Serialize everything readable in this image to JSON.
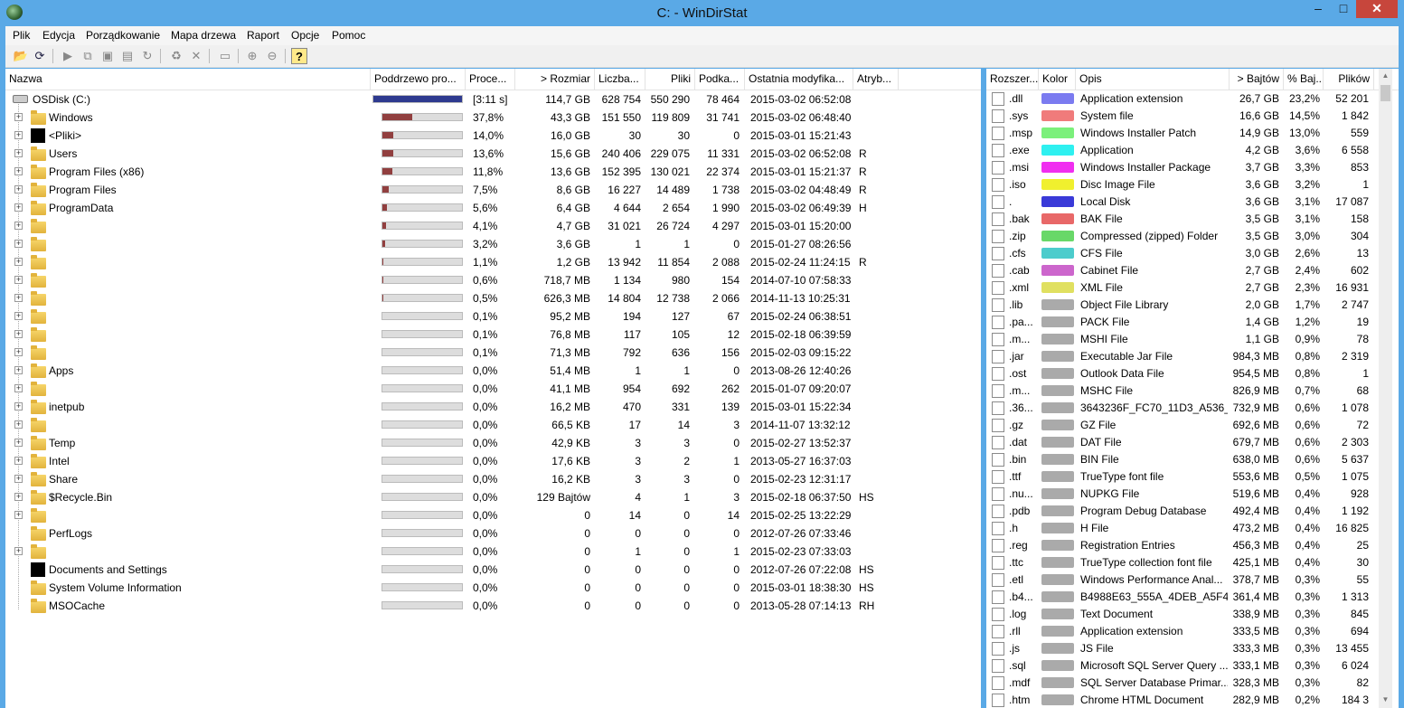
{
  "window": {
    "title": "C: - WinDirStat",
    "min": "–",
    "max": "□",
    "close": "✕"
  },
  "menu": [
    "Plik",
    "Edycja",
    "Porządkowanie",
    "Mapa drzewa",
    "Raport",
    "Opcje",
    "Pomoc"
  ],
  "toolbar_icons": [
    "open-folder-icon",
    "refresh-icon",
    "play-icon",
    "copy-icon",
    "explorer-icon",
    "cmd-icon",
    "refresh-selected-icon",
    "recycle-icon",
    "delete-icon",
    "new-folder-icon",
    "zoom-in-icon",
    "zoom-out-icon",
    "help-icon"
  ],
  "tree": {
    "headers": [
      "Nazwa",
      "Poddrzewo pro...",
      "Proce...",
      "> Rozmiar",
      "Liczba...",
      "Pliki",
      "Podka...",
      "Ostatnia modyfika...",
      "Atryb..."
    ],
    "rows": [
      {
        "name": "OSDisk (C:)",
        "icon": "drive-icon",
        "level": 0,
        "expand": false,
        "pct_fill": 1.0,
        "percent": "[3:11 s]",
        "size": "114,7 GB",
        "items": "628 754",
        "files": "550 290",
        "subdirs": "78 464",
        "modified": "2015-03-02  06:52:08",
        "attr": ""
      },
      {
        "name": "Windows",
        "icon": "folder-icon",
        "level": 1,
        "expand": true,
        "pct_fill": 0.378,
        "percent": "37,8%",
        "size": "43,3 GB",
        "items": "151 550",
        "files": "119 809",
        "subdirs": "31 741",
        "modified": "2015-03-02  06:48:40",
        "attr": ""
      },
      {
        "name": "<Pliki>",
        "icon": "files-icon",
        "level": 1,
        "expand": true,
        "pct_fill": 0.14,
        "percent": "14,0%",
        "size": "16,0 GB",
        "items": "30",
        "files": "30",
        "subdirs": "0",
        "modified": "2015-03-01  15:21:43",
        "attr": ""
      },
      {
        "name": "Users",
        "icon": "folder-icon",
        "level": 1,
        "expand": true,
        "pct_fill": 0.136,
        "percent": "13,6%",
        "size": "15,6 GB",
        "items": "240 406",
        "files": "229 075",
        "subdirs": "11 331",
        "modified": "2015-03-02  06:52:08",
        "attr": "R"
      },
      {
        "name": "Program Files (x86)",
        "icon": "folder-icon",
        "level": 1,
        "expand": true,
        "pct_fill": 0.118,
        "percent": "11,8%",
        "size": "13,6 GB",
        "items": "152 395",
        "files": "130 021",
        "subdirs": "22 374",
        "modified": "2015-03-01  15:21:37",
        "attr": "R"
      },
      {
        "name": "Program Files",
        "icon": "folder-icon",
        "level": 1,
        "expand": true,
        "pct_fill": 0.075,
        "percent": "7,5%",
        "size": "8,6 GB",
        "items": "16 227",
        "files": "14 489",
        "subdirs": "1 738",
        "modified": "2015-03-02  04:48:49",
        "attr": "R"
      },
      {
        "name": "ProgramData",
        "icon": "folder-icon",
        "level": 1,
        "expand": true,
        "pct_fill": 0.056,
        "percent": "5,6%",
        "size": "6,4 GB",
        "items": "4 644",
        "files": "2 654",
        "subdirs": "1 990",
        "modified": "2015-03-02  06:49:39",
        "attr": "H"
      },
      {
        "name": "",
        "icon": "folder-icon",
        "level": 1,
        "expand": true,
        "pct_fill": 0.041,
        "percent": "4,1%",
        "size": "4,7 GB",
        "items": "31 021",
        "files": "26 724",
        "subdirs": "4 297",
        "modified": "2015-03-01  15:20:00",
        "attr": ""
      },
      {
        "name": "",
        "icon": "folder-icon",
        "level": 1,
        "expand": true,
        "pct_fill": 0.032,
        "percent": "3,2%",
        "size": "3,6 GB",
        "items": "1",
        "files": "1",
        "subdirs": "0",
        "modified": "2015-01-27  08:26:56",
        "attr": ""
      },
      {
        "name": "",
        "icon": "folder-icon",
        "level": 1,
        "expand": true,
        "pct_fill": 0.011,
        "percent": "1,1%",
        "size": "1,2 GB",
        "items": "13 942",
        "files": "11 854",
        "subdirs": "2 088",
        "modified": "2015-02-24  11:24:15",
        "attr": "R"
      },
      {
        "name": "",
        "icon": "folder-icon",
        "level": 1,
        "expand": true,
        "pct_fill": 0.006,
        "percent": "0,6%",
        "size": "718,7 MB",
        "items": "1 134",
        "files": "980",
        "subdirs": "154",
        "modified": "2014-07-10  07:58:33",
        "attr": ""
      },
      {
        "name": "",
        "icon": "folder-icon",
        "level": 1,
        "expand": true,
        "pct_fill": 0.005,
        "percent": "0,5%",
        "size": "626,3 MB",
        "items": "14 804",
        "files": "12 738",
        "subdirs": "2 066",
        "modified": "2014-11-13  10:25:31",
        "attr": ""
      },
      {
        "name": "",
        "icon": "folder-icon",
        "level": 1,
        "expand": true,
        "pct_fill": 0.001,
        "percent": "0,1%",
        "size": "95,2 MB",
        "items": "194",
        "files": "127",
        "subdirs": "67",
        "modified": "2015-02-24  06:38:51",
        "attr": ""
      },
      {
        "name": "",
        "icon": "folder-icon",
        "level": 1,
        "expand": true,
        "pct_fill": 0.001,
        "percent": "0,1%",
        "size": "76,8 MB",
        "items": "117",
        "files": "105",
        "subdirs": "12",
        "modified": "2015-02-18  06:39:59",
        "attr": ""
      },
      {
        "name": "",
        "icon": "folder-icon",
        "level": 1,
        "expand": true,
        "pct_fill": 0.001,
        "percent": "0,1%",
        "size": "71,3 MB",
        "items": "792",
        "files": "636",
        "subdirs": "156",
        "modified": "2015-02-03  09:15:22",
        "attr": ""
      },
      {
        "name": "Apps",
        "icon": "folder-icon",
        "level": 1,
        "expand": true,
        "pct_fill": 0,
        "percent": "0,0%",
        "size": "51,4 MB",
        "items": "1",
        "files": "1",
        "subdirs": "0",
        "modified": "2013-08-26  12:40:26",
        "attr": ""
      },
      {
        "name": "",
        "icon": "folder-icon",
        "level": 1,
        "expand": true,
        "pct_fill": 0,
        "percent": "0,0%",
        "size": "41,1 MB",
        "items": "954",
        "files": "692",
        "subdirs": "262",
        "modified": "2015-01-07  09:20:07",
        "attr": ""
      },
      {
        "name": "inetpub",
        "icon": "folder-icon",
        "level": 1,
        "expand": true,
        "pct_fill": 0,
        "percent": "0,0%",
        "size": "16,2 MB",
        "items": "470",
        "files": "331",
        "subdirs": "139",
        "modified": "2015-03-01  15:22:34",
        "attr": ""
      },
      {
        "name": "",
        "icon": "folder-icon",
        "level": 1,
        "expand": true,
        "pct_fill": 0,
        "percent": "0,0%",
        "size": "66,5 KB",
        "items": "17",
        "files": "14",
        "subdirs": "3",
        "modified": "2014-11-07  13:32:12",
        "attr": ""
      },
      {
        "name": "Temp",
        "icon": "folder-icon",
        "level": 1,
        "expand": true,
        "pct_fill": 0,
        "percent": "0,0%",
        "size": "42,9 KB",
        "items": "3",
        "files": "3",
        "subdirs": "0",
        "modified": "2015-02-27  13:52:37",
        "attr": ""
      },
      {
        "name": "Intel",
        "icon": "folder-icon",
        "level": 1,
        "expand": true,
        "pct_fill": 0,
        "percent": "0,0%",
        "size": "17,6 KB",
        "items": "3",
        "files": "2",
        "subdirs": "1",
        "modified": "2013-05-27  16:37:03",
        "attr": ""
      },
      {
        "name": "Share",
        "icon": "folder-icon",
        "level": 1,
        "expand": true,
        "pct_fill": 0,
        "percent": "0,0%",
        "size": "16,2 KB",
        "items": "3",
        "files": "3",
        "subdirs": "0",
        "modified": "2015-02-23  12:31:17",
        "attr": ""
      },
      {
        "name": "$Recycle.Bin",
        "icon": "folder-icon",
        "level": 1,
        "expand": true,
        "pct_fill": 0,
        "percent": "0,0%",
        "size": "129 Bajtów",
        "items": "4",
        "files": "1",
        "subdirs": "3",
        "modified": "2015-02-18  06:37:50",
        "attr": "HS"
      },
      {
        "name": "",
        "icon": "folder-icon",
        "level": 1,
        "expand": true,
        "pct_fill": 0,
        "percent": "0,0%",
        "size": "0",
        "items": "14",
        "files": "0",
        "subdirs": "14",
        "modified": "2015-02-25  13:22:29",
        "attr": ""
      },
      {
        "name": "PerfLogs",
        "icon": "folder-icon",
        "level": 1,
        "expand": false,
        "pct_fill": 0,
        "percent": "0,0%",
        "size": "0",
        "items": "0",
        "files": "0",
        "subdirs": "0",
        "modified": "2012-07-26  07:33:46",
        "attr": ""
      },
      {
        "name": "",
        "icon": "folder-icon",
        "level": 1,
        "expand": true,
        "pct_fill": 0,
        "percent": "0,0%",
        "size": "0",
        "items": "1",
        "files": "0",
        "subdirs": "1",
        "modified": "2015-02-23  07:33:03",
        "attr": ""
      },
      {
        "name": "Documents and Settings",
        "icon": "files-icon",
        "level": 1,
        "expand": false,
        "pct_fill": 0,
        "percent": "0,0%",
        "size": "0",
        "items": "0",
        "files": "0",
        "subdirs": "0",
        "modified": "2012-07-26  07:22:08",
        "attr": "HS"
      },
      {
        "name": "System Volume Information",
        "icon": "folder-icon",
        "level": 1,
        "expand": false,
        "pct_fill": 0,
        "percent": "0,0%",
        "size": "0",
        "items": "0",
        "files": "0",
        "subdirs": "0",
        "modified": "2015-03-01  18:38:30",
        "attr": "HS"
      },
      {
        "name": "MSOCache",
        "icon": "folder-icon",
        "level": 1,
        "expand": false,
        "pct_fill": 0,
        "percent": "0,0%",
        "size": "0",
        "items": "0",
        "files": "0",
        "subdirs": "0",
        "modified": "2013-05-28  07:14:13",
        "attr": "RH"
      }
    ]
  },
  "extensions": {
    "headers": [
      "Rozszer...",
      "Kolor",
      "Opis",
      "> Bajtów",
      "% Baj...",
      "Plików"
    ],
    "rows": [
      {
        "ext": ".dll",
        "color": "#7b7bf0",
        "desc": "Application extension",
        "bytes": "26,7 GB",
        "pct": "23,2%",
        "files": "52 201"
      },
      {
        "ext": ".sys",
        "color": "#f07b7b",
        "desc": "System file",
        "bytes": "16,6 GB",
        "pct": "14,5%",
        "files": "1 842"
      },
      {
        "ext": ".msp",
        "color": "#7bf07b",
        "desc": "Windows Installer Patch",
        "bytes": "14,9 GB",
        "pct": "13,0%",
        "files": "559"
      },
      {
        "ext": ".exe",
        "color": "#2ef0f0",
        "desc": "Application",
        "bytes": "4,2 GB",
        "pct": "3,6%",
        "files": "6 558"
      },
      {
        "ext": ".msi",
        "color": "#f02ef0",
        "desc": "Windows Installer Package",
        "bytes": "3,7 GB",
        "pct": "3,3%",
        "files": "853"
      },
      {
        "ext": ".iso",
        "color": "#f0f02e",
        "desc": "Disc Image File",
        "bytes": "3,6 GB",
        "pct": "3,2%",
        "files": "1"
      },
      {
        "ext": ".",
        "color": "#3a3ad8",
        "desc": "Local Disk",
        "bytes": "3,6 GB",
        "pct": "3,1%",
        "files": "17 087"
      },
      {
        "ext": ".bak",
        "color": "#e86868",
        "desc": "BAK File",
        "bytes": "3,5 GB",
        "pct": "3,1%",
        "files": "158"
      },
      {
        "ext": ".zip",
        "color": "#68d868",
        "desc": "Compressed (zipped) Folder",
        "bytes": "3,5 GB",
        "pct": "3,0%",
        "files": "304"
      },
      {
        "ext": ".cfs",
        "color": "#4ccccc",
        "desc": "CFS File",
        "bytes": "3,0 GB",
        "pct": "2,6%",
        "files": "13"
      },
      {
        "ext": ".cab",
        "color": "#cc66cc",
        "desc": "Cabinet File",
        "bytes": "2,7 GB",
        "pct": "2,4%",
        "files": "602"
      },
      {
        "ext": ".xml",
        "color": "#e0e060",
        "desc": "XML File",
        "bytes": "2,7 GB",
        "pct": "2,3%",
        "files": "16 931"
      },
      {
        "ext": ".lib",
        "color": "#aaaaaa",
        "desc": "Object File Library",
        "bytes": "2,0 GB",
        "pct": "1,7%",
        "files": "2 747"
      },
      {
        "ext": ".pa...",
        "color": "#aaaaaa",
        "desc": "PACK File",
        "bytes": "1,4 GB",
        "pct": "1,2%",
        "files": "19"
      },
      {
        "ext": ".m...",
        "color": "#aaaaaa",
        "desc": "MSHI File",
        "bytes": "1,1 GB",
        "pct": "0,9%",
        "files": "78"
      },
      {
        "ext": ".jar",
        "color": "#aaaaaa",
        "desc": "Executable Jar File",
        "bytes": "984,3 MB",
        "pct": "0,8%",
        "files": "2 319"
      },
      {
        "ext": ".ost",
        "color": "#aaaaaa",
        "desc": "Outlook Data File",
        "bytes": "954,5 MB",
        "pct": "0,8%",
        "files": "1"
      },
      {
        "ext": ".m...",
        "color": "#aaaaaa",
        "desc": "MSHC File",
        "bytes": "826,9 MB",
        "pct": "0,7%",
        "files": "68"
      },
      {
        "ext": ".36...",
        "color": "#aaaaaa",
        "desc": "3643236F_FC70_11D3_A536_...",
        "bytes": "732,9 MB",
        "pct": "0,6%",
        "files": "1 078"
      },
      {
        "ext": ".gz",
        "color": "#aaaaaa",
        "desc": "GZ File",
        "bytes": "692,6 MB",
        "pct": "0,6%",
        "files": "72"
      },
      {
        "ext": ".dat",
        "color": "#aaaaaa",
        "desc": "DAT File",
        "bytes": "679,7 MB",
        "pct": "0,6%",
        "files": "2 303"
      },
      {
        "ext": ".bin",
        "color": "#aaaaaa",
        "desc": "BIN File",
        "bytes": "638,0 MB",
        "pct": "0,6%",
        "files": "5 637"
      },
      {
        "ext": ".ttf",
        "color": "#aaaaaa",
        "desc": "TrueType font file",
        "bytes": "553,6 MB",
        "pct": "0,5%",
        "files": "1 075"
      },
      {
        "ext": ".nu...",
        "color": "#aaaaaa",
        "desc": "NUPKG File",
        "bytes": "519,6 MB",
        "pct": "0,4%",
        "files": "928"
      },
      {
        "ext": ".pdb",
        "color": "#aaaaaa",
        "desc": "Program Debug Database",
        "bytes": "492,4 MB",
        "pct": "0,4%",
        "files": "1 192"
      },
      {
        "ext": ".h",
        "color": "#aaaaaa",
        "desc": "H File",
        "bytes": "473,2 MB",
        "pct": "0,4%",
        "files": "16 825"
      },
      {
        "ext": ".reg",
        "color": "#aaaaaa",
        "desc": "Registration Entries",
        "bytes": "456,3 MB",
        "pct": "0,4%",
        "files": "25"
      },
      {
        "ext": ".ttc",
        "color": "#aaaaaa",
        "desc": "TrueType collection font file",
        "bytes": "425,1 MB",
        "pct": "0,4%",
        "files": "30"
      },
      {
        "ext": ".etl",
        "color": "#aaaaaa",
        "desc": "Windows Performance Anal...",
        "bytes": "378,7 MB",
        "pct": "0,3%",
        "files": "55"
      },
      {
        "ext": ".b4...",
        "color": "#aaaaaa",
        "desc": "B4988E63_555A_4DEB_A5F4_...",
        "bytes": "361,4 MB",
        "pct": "0,3%",
        "files": "1 313"
      },
      {
        "ext": ".log",
        "color": "#aaaaaa",
        "desc": "Text Document",
        "bytes": "338,9 MB",
        "pct": "0,3%",
        "files": "845"
      },
      {
        "ext": ".rll",
        "color": "#aaaaaa",
        "desc": "Application extension",
        "bytes": "333,5 MB",
        "pct": "0,3%",
        "files": "694"
      },
      {
        "ext": ".js",
        "color": "#aaaaaa",
        "desc": "JS File",
        "bytes": "333,3 MB",
        "pct": "0,3%",
        "files": "13 455"
      },
      {
        "ext": ".sql",
        "color": "#aaaaaa",
        "desc": "Microsoft SQL Server Query ...",
        "bytes": "333,1 MB",
        "pct": "0,3%",
        "files": "6 024"
      },
      {
        "ext": ".mdf",
        "color": "#aaaaaa",
        "desc": "SQL Server Database Primar...",
        "bytes": "328,3 MB",
        "pct": "0,3%",
        "files": "82"
      },
      {
        "ext": ".htm",
        "color": "#aaaaaa",
        "desc": "Chrome HTML Document",
        "bytes": "282,9 MB",
        "pct": "0,2%",
        "files": "184 3"
      }
    ]
  }
}
